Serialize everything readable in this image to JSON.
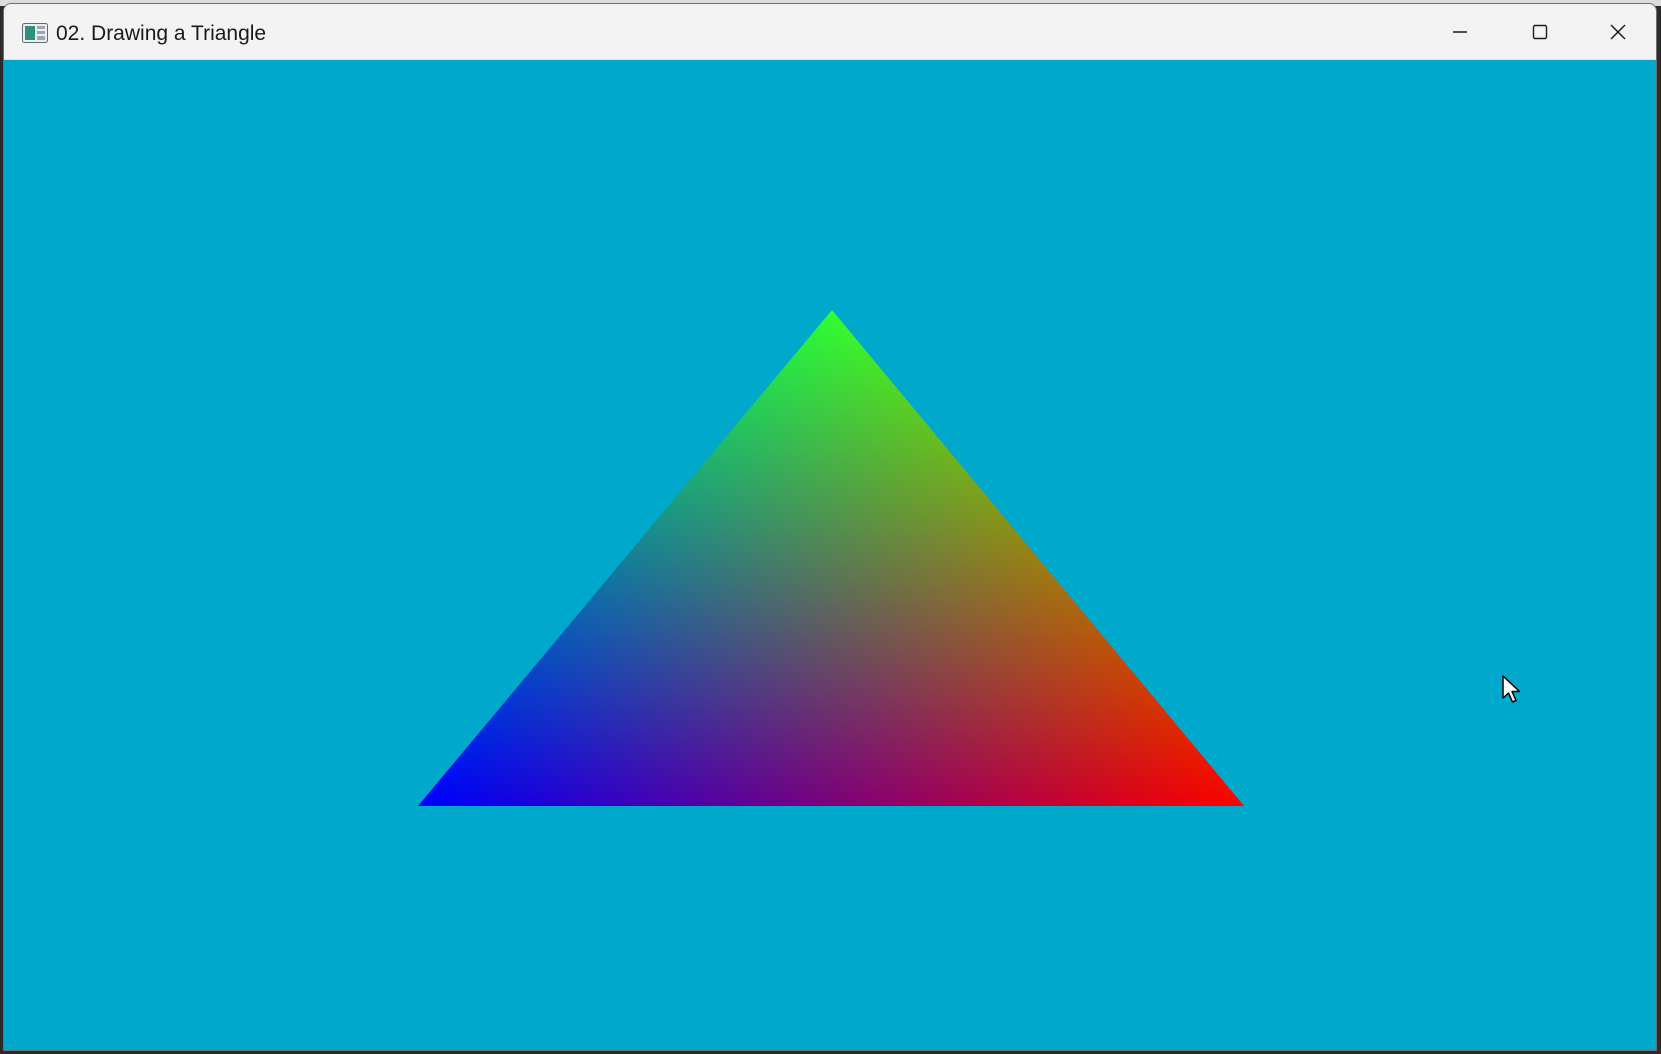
{
  "window": {
    "title": "02. Drawing a Triangle",
    "app_icon": "app-window-icon",
    "controls": {
      "minimize_icon": "minimize-icon",
      "maximize_icon": "maximize-icon",
      "close_icon": "close-icon"
    }
  },
  "canvas": {
    "clear_color": "#00a8cc",
    "triangle": {
      "vertex_colors": {
        "top": "#00ff00",
        "bottom_left": "#0000ff",
        "bottom_right": "#ff0000"
      }
    }
  },
  "cursor": {
    "icon": "mouse-pointer-icon"
  }
}
